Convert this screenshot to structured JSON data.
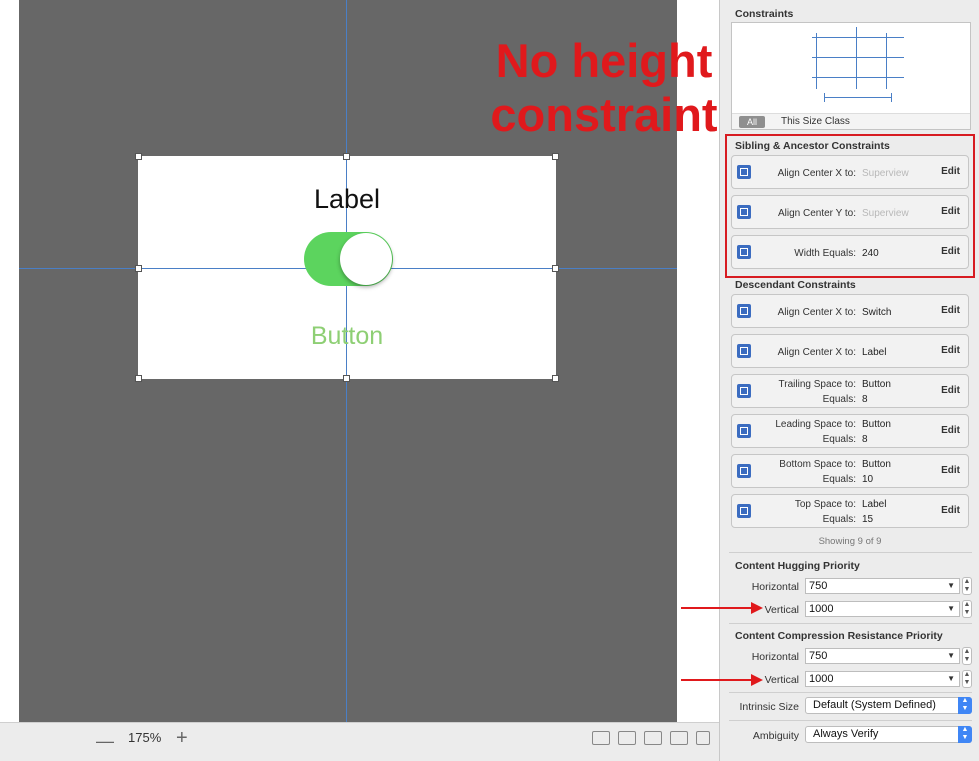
{
  "canvas": {
    "label_text": "Label",
    "button_text": "Button",
    "switch_on": true
  },
  "annotation": {
    "line1": "No height",
    "line2": "constraint"
  },
  "bottom_bar": {
    "zoom_out_icon": "minus-icon",
    "zoom_level": "175%",
    "zoom_in_icon": "plus-icon"
  },
  "inspector": {
    "constraints_title": "Constraints",
    "tab_all": "All",
    "tab_size_class": "This Size Class",
    "sibling_title": "Sibling & Ancestor Constraints",
    "sibling": [
      {
        "label": "Align Center X to:",
        "value": "Superview",
        "edit": "Edit"
      },
      {
        "label": "Align Center Y to:",
        "value": "Superview",
        "edit": "Edit"
      },
      {
        "label": "Width Equals:",
        "value": "240",
        "edit": "Edit"
      }
    ],
    "descendant_title": "Descendant Constraints",
    "descendant": [
      {
        "label": "Align Center X to:",
        "value": "Switch",
        "edit": "Edit"
      },
      {
        "label": "Align Center X to:",
        "value": "Label",
        "edit": "Edit"
      },
      {
        "label1": "Trailing Space to:",
        "value1": "Button",
        "label2": "Equals:",
        "value2": "8",
        "edit": "Edit"
      },
      {
        "label1": "Leading Space to:",
        "value1": "Button",
        "label2": "Equals:",
        "value2": "8",
        "edit": "Edit"
      },
      {
        "label1": "Bottom Space to:",
        "value1": "Button",
        "label2": "Equals:",
        "value2": "10",
        "edit": "Edit"
      },
      {
        "label1": "Top Space to:",
        "value1": "Label",
        "label2": "Equals:",
        "value2": "15",
        "edit": "Edit"
      }
    ],
    "showing": "Showing 9 of 9",
    "hugging_title": "Content Hugging Priority",
    "hugging": {
      "h_label": "Horizontal",
      "h_value": "750",
      "v_label": "Vertical",
      "v_value": "1000"
    },
    "compression_title": "Content Compression Resistance Priority",
    "compression": {
      "h_label": "Horizontal",
      "h_value": "750",
      "v_label": "Vertical",
      "v_value": "1000"
    },
    "intrinsic_label": "Intrinsic Size",
    "intrinsic_value": "Default (System Defined)",
    "ambiguity_label": "Ambiguity",
    "ambiguity_value": "Always Verify"
  },
  "colors": {
    "canvas_bg": "#676767",
    "guide": "#4a7fc6",
    "switch_on": "#5cd45e",
    "button_text": "#8ecf74",
    "annotation_red": "#e0191c"
  }
}
